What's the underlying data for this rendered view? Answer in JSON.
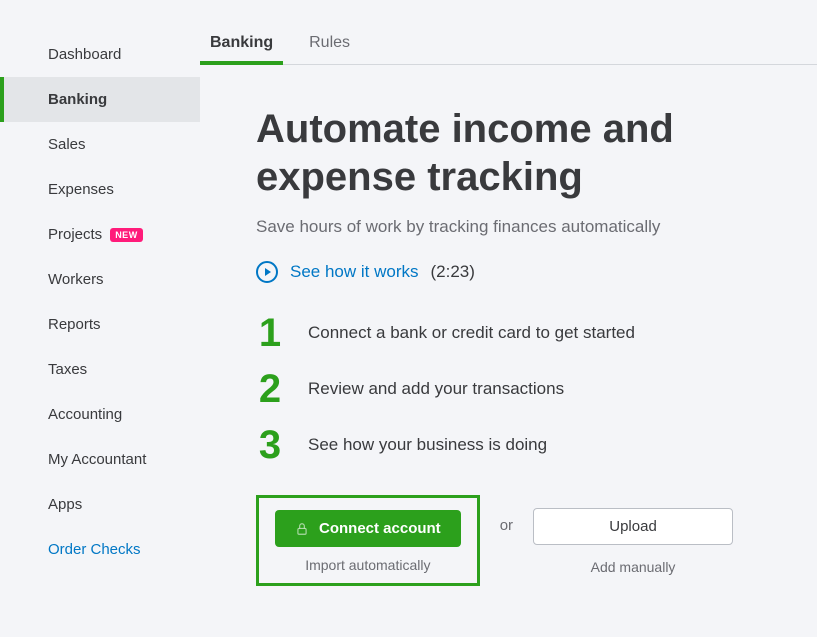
{
  "sidebar": {
    "items": [
      {
        "label": "Dashboard"
      },
      {
        "label": "Banking"
      },
      {
        "label": "Sales"
      },
      {
        "label": "Expenses"
      },
      {
        "label": "Projects",
        "badge": "NEW"
      },
      {
        "label": "Workers"
      },
      {
        "label": "Reports"
      },
      {
        "label": "Taxes"
      },
      {
        "label": "Accounting"
      },
      {
        "label": "My Accountant"
      },
      {
        "label": "Apps"
      },
      {
        "label": "Order Checks"
      }
    ]
  },
  "tabs": [
    {
      "label": "Banking"
    },
    {
      "label": "Rules"
    }
  ],
  "page": {
    "title": "Automate income and expense tracking",
    "subtitle": "Save hours of work by tracking finances automatically",
    "video_link": "See how it works",
    "video_duration": "(2:23)",
    "steps": [
      "Connect a bank or credit card to get started",
      "Review and add your transactions",
      "See how your business is doing"
    ],
    "connect_label": "Connect account",
    "connect_hint": "Import automatically",
    "or_label": "or",
    "upload_label": "Upload",
    "upload_hint": "Add manually"
  }
}
